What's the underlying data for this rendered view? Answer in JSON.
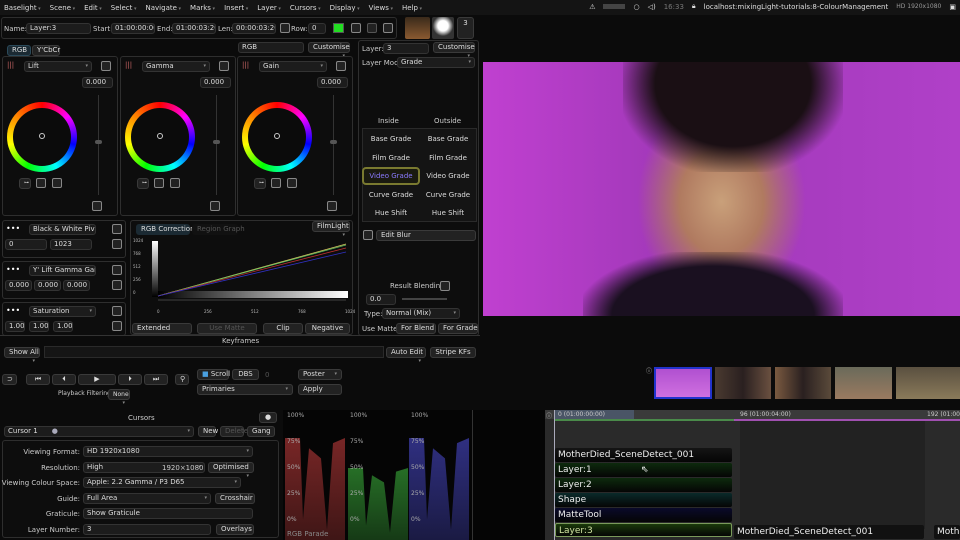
{
  "menu": [
    "Baselight",
    "Scene",
    "Edit",
    "Select",
    "Navigate",
    "Marks",
    "Insert",
    "Layer",
    "Cursors",
    "Display",
    "Views",
    "Help"
  ],
  "system": {
    "time": "16:33",
    "url": "localhost:mixingLight-tutorials:8-ColourManagement",
    "format": "HD 1920x1080"
  },
  "toolbar": {
    "name_label": "Name:",
    "name": "Layer:3",
    "start_label": "Start:",
    "start": "01:00:00:00",
    "end_label": "End:",
    "end": "01:00:03:20",
    "len_label": "Len:",
    "len": "00:00:03:20",
    "row_label": "Row:",
    "row": "0",
    "layer_count": "3",
    "status_color": "#22dd22"
  },
  "grade": {
    "tabs": [
      "RGB",
      "Y'CbCr"
    ],
    "space": "RGB",
    "customise": "Customise",
    "wheels": [
      {
        "name": "Lift",
        "value": "0.000"
      },
      {
        "name": "Gamma",
        "value": "0.000"
      },
      {
        "name": "Gain",
        "value": "0.000"
      }
    ]
  },
  "params": [
    {
      "name": "Black & White Pivot",
      "values": [
        "0",
        "1023"
      ]
    },
    {
      "name": "Y' Lift Gamma Gain",
      "values": [
        "0.000",
        "0.000",
        "0.000"
      ]
    },
    {
      "name": "Saturation",
      "values": [
        "1.00",
        "1.00",
        "1.00"
      ]
    }
  ],
  "curves": {
    "tabs": [
      "RGB Correction",
      "Region Graph"
    ],
    "preset": "FilmLight",
    "yticks": [
      "1024",
      "768",
      "512",
      "256",
      "0"
    ],
    "xticks": [
      "0",
      "256",
      "512",
      "768",
      "1024"
    ],
    "buttons": [
      "Extended",
      "Use Matte",
      "Clip",
      "Negative"
    ]
  },
  "layer_panel": {
    "layer_label": "Layer:",
    "layer": "3",
    "customise": "Customise",
    "mode_label": "Layer Mode",
    "mode": "Grade",
    "inside": "Inside",
    "outside": "Outside",
    "grades": [
      "Base Grade",
      "Film Grade",
      "Video Grade",
      "Curve Grade",
      "Hue Shift"
    ],
    "active_inside": "Video Grade",
    "edit_blur": "Edit Blur",
    "result_blending": "Result Blending",
    "blend_value": "0.0",
    "type_label": "Type:",
    "type": "Normal (Mix)",
    "use_matte": "Use Matte:",
    "for_blend": "For Blend",
    "for_grade": "For Grade"
  },
  "keyframes": {
    "title": "Keyframes",
    "show": "Show All",
    "auto_edit": "Auto Edit",
    "stripe": "Stripe KFs"
  },
  "transport": {
    "playback_filtering": "Playback Filtering",
    "filter": "None",
    "scroll": "Scroll",
    "dbs": "DBS",
    "dbs_value": "0",
    "poster": "Poster",
    "primaries": "Primaries",
    "apply": "Apply"
  },
  "cursors": {
    "title": "Cursors",
    "cursor": "Cursor 1",
    "new": "New",
    "delete": "Delete",
    "gang": "Gang",
    "rows": [
      {
        "label": "Viewing Format:",
        "value": "HD 1920x1080"
      },
      {
        "label": "Resolution:",
        "value": "High",
        "extra": "1920×1080",
        "extra2": "Optimised"
      },
      {
        "label": "Viewing Colour Space:",
        "value": "Apple: 2.2 Gamma / P3 D65"
      },
      {
        "label": "Guide:",
        "value": "Full Area",
        "extra": "Crosshair"
      },
      {
        "label": "Graticule:",
        "value": "Show Graticule"
      },
      {
        "label": "Layer Number:",
        "value": "3",
        "extra": "Overlays"
      }
    ]
  },
  "scopes": {
    "title": "RGB Parade",
    "levels": [
      "100%",
      "75%",
      "50%",
      "25%",
      "0%"
    ]
  },
  "timeline": {
    "ticks": [
      "0 (01:00:00:00)",
      "96 (01:00:04:00)",
      "192 (01:00"
    ],
    "layers": [
      "MotherDied_SceneDetect_001",
      "Layer:1",
      "Layer:2",
      "Shape",
      "MatteTool",
      "Layer:3"
    ],
    "next_clip": "MotherDied_SceneDetect_001",
    "next_clip2": "Moth"
  }
}
